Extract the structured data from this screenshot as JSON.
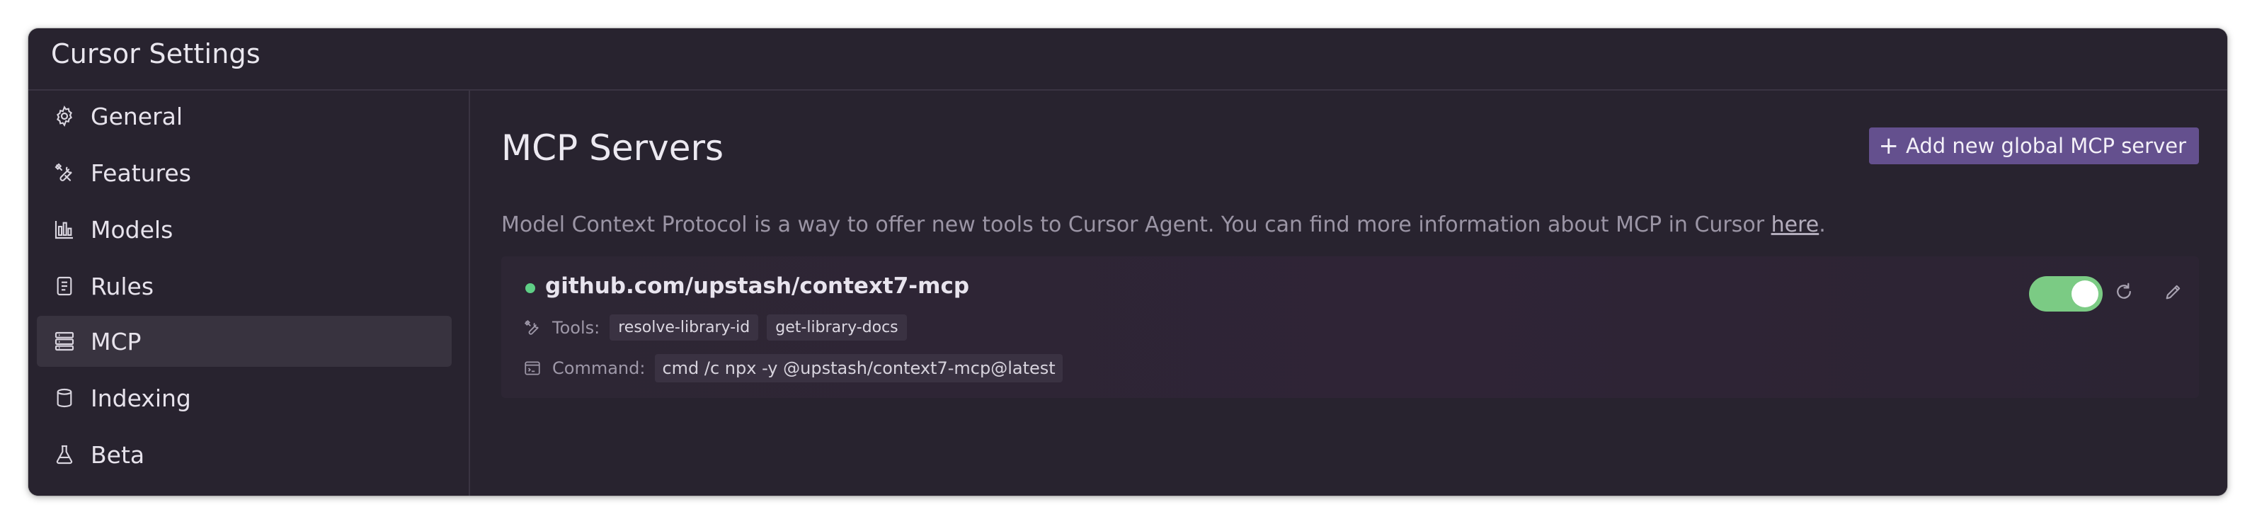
{
  "window": {
    "title": "Cursor Settings"
  },
  "sidebar": {
    "items": [
      {
        "label": "General",
        "icon": "gear-icon",
        "active": false
      },
      {
        "label": "Features",
        "icon": "tools-icon",
        "active": false
      },
      {
        "label": "Models",
        "icon": "bar-chart-icon",
        "active": false
      },
      {
        "label": "Rules",
        "icon": "document-icon",
        "active": false
      },
      {
        "label": "MCP",
        "icon": "server-stack-icon",
        "active": true
      },
      {
        "label": "Indexing",
        "icon": "database-icon",
        "active": false
      },
      {
        "label": "Beta",
        "icon": "flask-icon",
        "active": false
      }
    ]
  },
  "main": {
    "title": "MCP Servers",
    "add_button_label": "Add new global MCP server",
    "description_prefix": "Model Context Protocol is a way to offer new tools to Cursor Agent. You can find more information about MCP in Cursor ",
    "description_link": "here",
    "description_suffix": ".",
    "servers": [
      {
        "name": "github.com/upstash/context7-mcp",
        "status": "connected",
        "enabled": true,
        "tools_label": "Tools:",
        "tools": [
          "resolve-library-id",
          "get-library-docs"
        ],
        "command_label": "Command:",
        "command": "cmd /c npx -y @upstash/context7-mcp@latest"
      }
    ]
  },
  "colors": {
    "window_bg": "#28232f",
    "accent_button": "#64508e",
    "status_green": "#5fcf86",
    "toggle_on": "#7bcb84",
    "text_primary": "#e9e6ee",
    "text_muted": "#9b95a5"
  }
}
